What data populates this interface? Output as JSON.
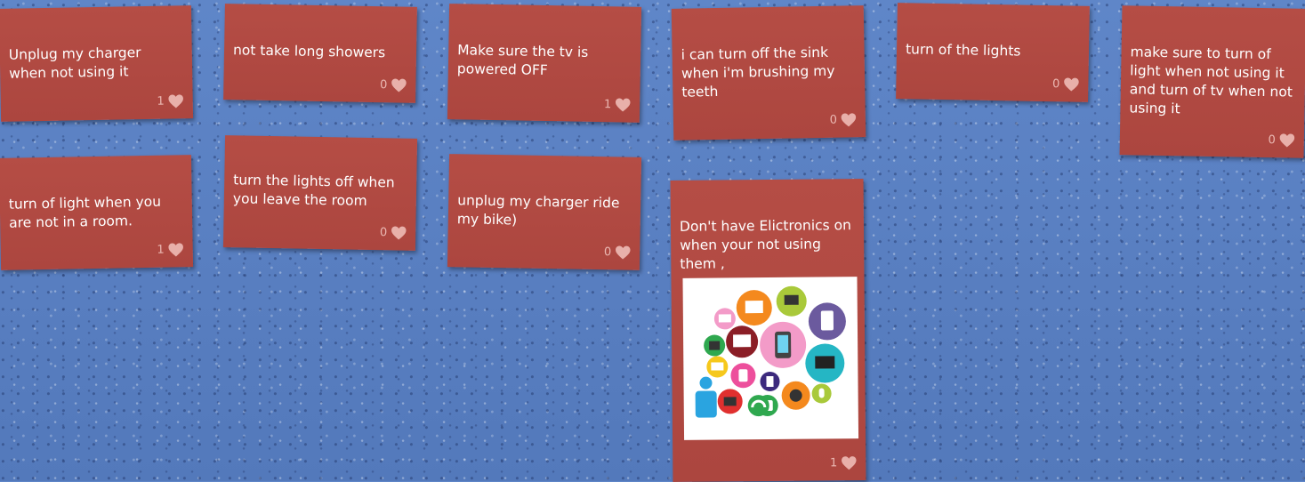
{
  "cards": [
    {
      "text": "Unplug my charger when not using it",
      "likes": "1"
    },
    {
      "text": "not take long showers",
      "likes": "0"
    },
    {
      "text": "Make sure the tv is powered OFF",
      "likes": "1"
    },
    {
      "text": "i can turn off the sink when i'm brushing my teeth",
      "likes": "0"
    },
    {
      "text": "turn of the lights",
      "likes": "0"
    },
    {
      "text": "make sure to turn of light when not using it and turn of tv when not using it",
      "likes": "0"
    },
    {
      "text": "turn of light when you are not in a room.",
      "likes": "1"
    },
    {
      "text": "turn the lights off when you leave the room",
      "likes": "0"
    },
    {
      "text": "unplug my charger ride my bike)",
      "likes": "0"
    },
    {
      "text": "Don't have Elictronics on when your not using them ,",
      "likes": "1",
      "image": "electronics-devices-illustration"
    }
  ],
  "icons": {
    "like": "heart-icon"
  },
  "colors": {
    "board": "#5a82c4",
    "card": "#b04a42",
    "heart": "#e8b0aa"
  }
}
